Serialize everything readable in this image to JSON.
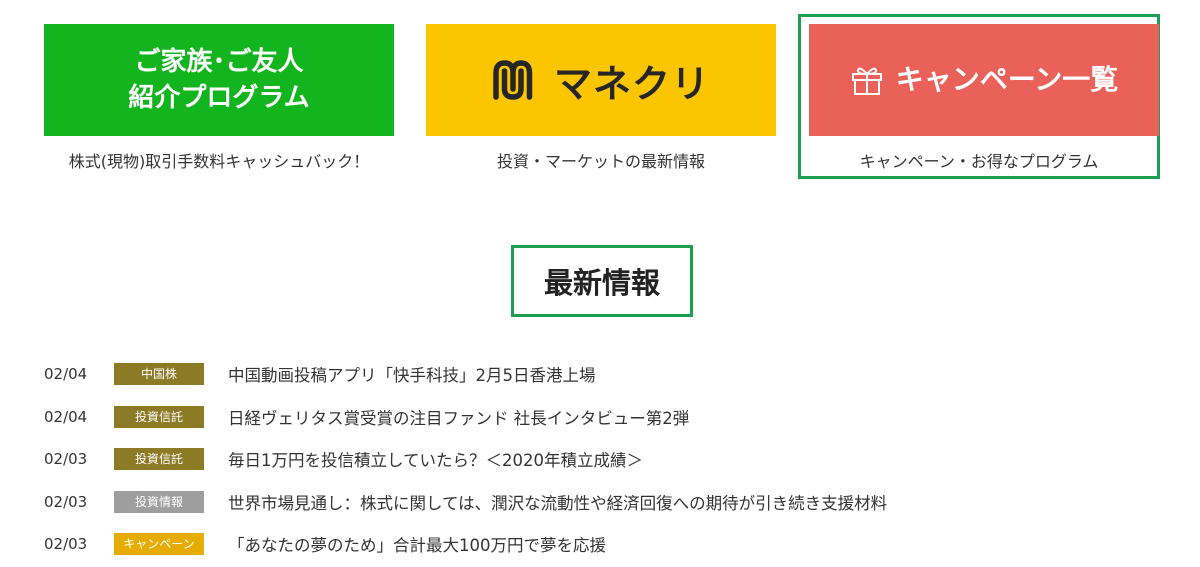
{
  "banners": [
    {
      "title_line1": "ご家族･ご友人",
      "title_line2": "紹介プログラム",
      "caption": "株式(現物)取引手数料キャッシュバック！",
      "color": "#13b51e"
    },
    {
      "title": "マネクリ",
      "caption": "投資・マーケットの最新情報",
      "color": "#fbc600"
    },
    {
      "title": "キャンペーン一覧",
      "caption": "キャンペーン・お得なプログラム",
      "color": "#ea6159"
    }
  ],
  "section_title": "最新情報",
  "news": [
    {
      "date": "02/04",
      "tag": "中国株",
      "tag_color": "#8d7a25",
      "headline": "中国動画投稿アプリ「快手科技」2月5日香港上場"
    },
    {
      "date": "02/04",
      "tag": "投資信託",
      "tag_color": "#8d7a25",
      "headline": "日経ヴェリタス賞受賞の注目ファンド 社長インタビュー第2弾"
    },
    {
      "date": "02/03",
      "tag": "投資信託",
      "tag_color": "#8d7a25",
      "headline": "毎日1万円を投信積立していたら？＜2020年積立成績＞"
    },
    {
      "date": "02/03",
      "tag": "投資情報",
      "tag_color": "#9e9e9e",
      "headline": "世界市場見通し：株式に関しては、潤沢な流動性や経済回復への期待が引き続き支援材料"
    },
    {
      "date": "02/03",
      "tag": "キャンペーン",
      "tag_color": "#e6ad00",
      "headline": "「あなたの夢のため」合計最大100万円で夢を応援"
    }
  ],
  "icons": {
    "monex_logo": "monecli-m-logo-icon",
    "gift": "gift-icon"
  }
}
